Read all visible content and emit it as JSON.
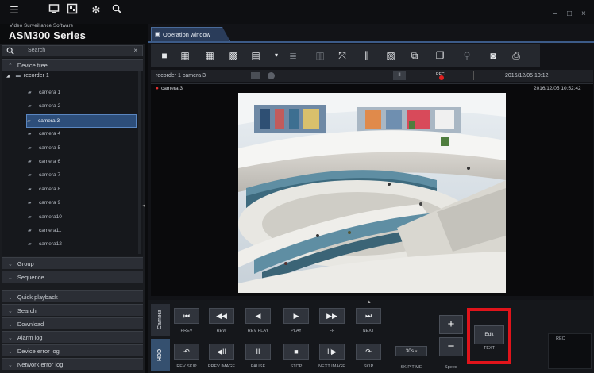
{
  "app": {
    "subtitle": "Video Surveillance Software",
    "title": "ASM300 Series"
  },
  "topbar_icons": [
    "menu-icon",
    "monitor-icon",
    "layout-icon",
    "gear-icon",
    "search-icon"
  ],
  "window_controls": [
    "–",
    "□",
    "×"
  ],
  "sidebar": {
    "search_label": "Search",
    "device_tree_label": "Device tree",
    "recorder": "recorder 1",
    "cameras": [
      "camera 1",
      "camera 2",
      "camera 3",
      "camera 4",
      "camera 5",
      "camera 6",
      "camera 7",
      "camera 8",
      "camera 9",
      "camera10",
      "camera11",
      "camera12"
    ],
    "selected_camera": "camera 3",
    "sections_mid": [
      "Group",
      "Sequence"
    ],
    "sections_bottom": [
      "Quick playback",
      "Search",
      "Download",
      "Alarm log",
      "Device error log",
      "Network error log"
    ]
  },
  "main": {
    "tab_label": "Operation window",
    "info": {
      "source": "recorder 1 camera 3",
      "rec": "REC",
      "datetime": "2016/12/05 10:12"
    },
    "camera_label": "camera 3",
    "video_timestamp": "2016/12/05 10:52:42"
  },
  "playback": {
    "tabs": [
      "Camera",
      "HDD"
    ],
    "row1": [
      {
        "icon": "⏮",
        "label": "PREV"
      },
      {
        "icon": "◀◀",
        "label": "REW"
      },
      {
        "icon": "◀",
        "label": "REV PLAY"
      },
      {
        "icon": "▶",
        "label": "PLAY"
      },
      {
        "icon": "▶▶",
        "label": "FF"
      },
      {
        "icon": "⏭",
        "label": "NEXT"
      }
    ],
    "row2": [
      {
        "icon": "↶",
        "label": "REV SKIP"
      },
      {
        "icon": "◀II",
        "label": "PREV IMAGE"
      },
      {
        "icon": "II",
        "label": "PAUSE"
      },
      {
        "icon": "■",
        "label": "STOP"
      },
      {
        "icon": "II▶",
        "label": "NEXT IMAGE"
      },
      {
        "icon": "↷",
        "label": "SKIP"
      }
    ],
    "skip_time_value": "30s",
    "skip_time_label": "SKIP TIME",
    "speed_label": "Speed",
    "edit_label": "Edit",
    "text_label": "TEXT",
    "rec_label": "REC"
  }
}
